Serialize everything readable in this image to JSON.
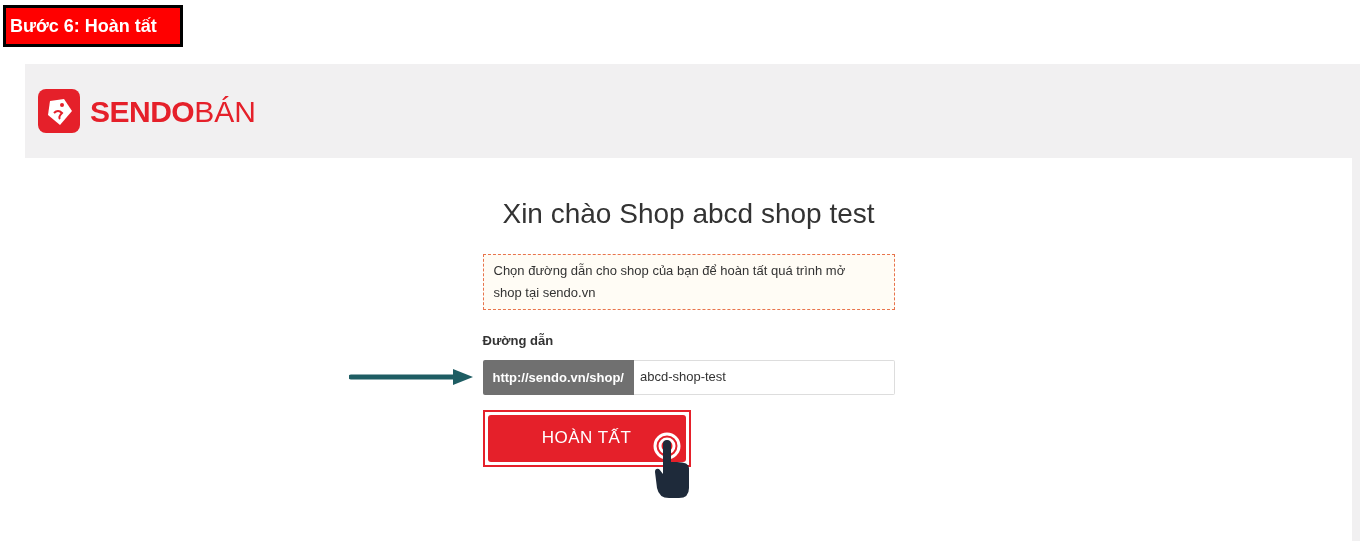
{
  "step_label": "Bước 6: Hoàn tất",
  "header": {
    "logo_bold": "SENDO",
    "logo_light": "BÁN"
  },
  "title": "Xin chào Shop abcd shop test",
  "notice": "Chọn đường dẫn cho shop của bạn để hoàn tất quá trình mở shop tại sendo.vn",
  "url_field": {
    "label": "Đường dẫn",
    "prefix": "http://sendo.vn/shop/",
    "value": "abcd-shop-test"
  },
  "submit_button": {
    "label": "HOÀN TẤT"
  }
}
